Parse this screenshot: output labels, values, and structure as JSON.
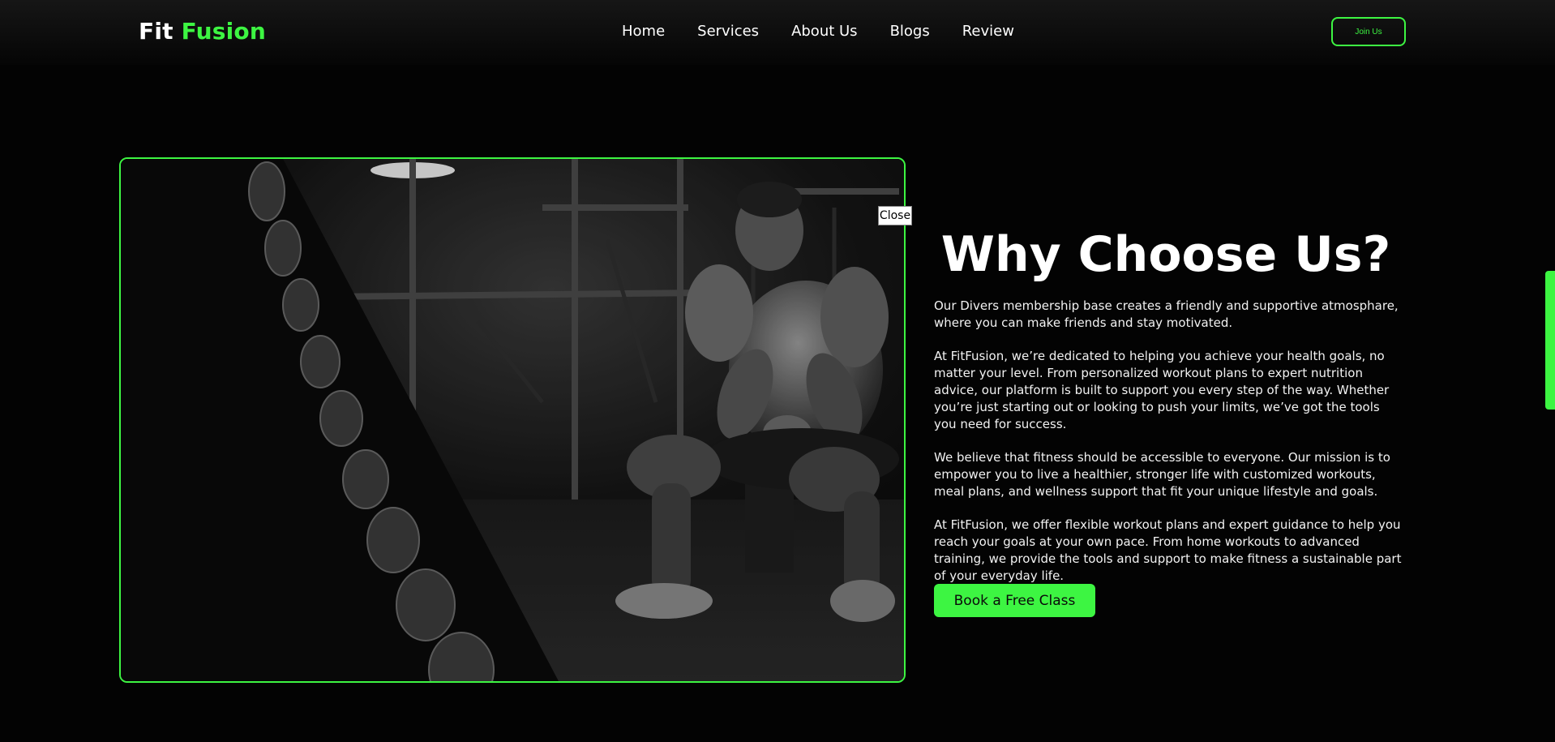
{
  "brand": {
    "first": "Fit",
    "second": "Fusion",
    "accent_color": "#3df542"
  },
  "nav": {
    "links": [
      "Home",
      "Services",
      "About Us",
      "Blogs",
      "Review"
    ],
    "join_label": "Join Us"
  },
  "hero": {
    "image": {
      "description_icon": "bodybuilder-gym-photo"
    },
    "close_label": "Close",
    "title": "Why Choose Us?",
    "paragraphs": [
      "Our Divers membership base creates a friendly and supportive atmosphare, where you can make friends and stay motivated.",
      "At FitFusion, we’re dedicated to helping you achieve your health goals, no matter your level. From personalized workout plans to expert nutrition advice, our platform is built to support you every step of the way. Whether you’re just starting out or looking to push your limits, we’ve got the tools you need for success.",
      "We believe that fitness should be accessible to everyone. Our mission is to empower you to live a healthier, stronger life with customized workouts, meal plans, and wellness support that fit your unique lifestyle and goals.",
      "At FitFusion, we offer flexible workout plans and expert guidance to help you reach your goals at your own pace. From home workouts to advanced training, we provide the tools and support to make fitness a sustainable part of your everyday life."
    ],
    "cta_label": "Book a Free Class"
  }
}
